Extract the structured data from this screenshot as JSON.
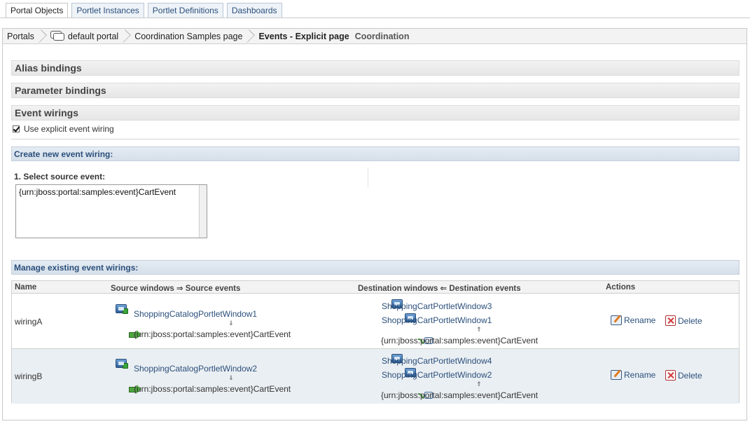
{
  "tabs": [
    "Portal Objects",
    "Portlet Instances",
    "Portlet Definitions",
    "Dashboards"
  ],
  "breadcrumb": {
    "portals": "Portals",
    "portal": "default portal",
    "page": "Coordination Samples page",
    "current": "Events - Explicit page",
    "extra": "Coordination"
  },
  "sections": {
    "alias": "Alias bindings",
    "parameter": "Parameter bindings",
    "events": "Event wirings"
  },
  "explicit_wiring": {
    "label": "Use explicit event wiring",
    "checked": true
  },
  "create": {
    "header": "Create new event wiring:",
    "step_label": "1. Select source event:",
    "options": [
      "{urn:jboss:portal:samples:event}CartEvent"
    ]
  },
  "manage": {
    "header": "Manage existing event wirings:",
    "columns": {
      "name": "Name",
      "source": "Source windows ⇒ Source events",
      "destination": "Destination windows ⇐ Destination events",
      "actions": "Actions"
    },
    "down_arrow": "⇓",
    "up_arrow": "⇑",
    "rename": "Rename",
    "delete": "Delete",
    "rows": [
      {
        "name": "wiringA",
        "source_window": "ShoppingCatalogPortletWindow1",
        "source_event": "{urn:jboss:portal:samples:event}CartEvent",
        "dest_windows": [
          "ShoppingCartPortletWindow3",
          "ShoppingCartPortletWindow1"
        ],
        "dest_event": "{urn:jboss:portal:samples:event}CartEvent"
      },
      {
        "name": "wiringB",
        "source_window": "ShoppingCatalogPortletWindow2",
        "source_event": "{urn:jboss:portal:samples:event}CartEvent",
        "dest_windows": [
          "ShoppingCartPortletWindow4",
          "ShoppingCartPortletWindow2"
        ],
        "dest_event": "{urn:jboss:portal:samples:event}CartEvent"
      }
    ]
  },
  "colors": {
    "link": "#2b4f7b",
    "header_bar": "#d6e0ea",
    "row_alt": "#eaeff3"
  }
}
